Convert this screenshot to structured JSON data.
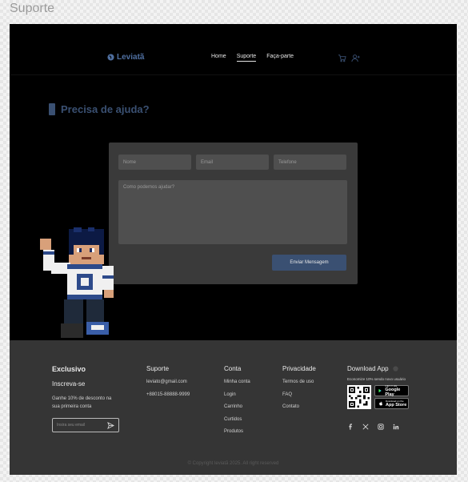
{
  "frame": {
    "title": "Suporte"
  },
  "header": {
    "brand": "Leviatã",
    "nav": [
      "Home",
      "Suporte",
      "Faça-parte"
    ],
    "active_index": 1
  },
  "help": {
    "title": "Precisa de ajuda?"
  },
  "form": {
    "name_placeholder": "Nome",
    "email_placeholder": "Email",
    "phone_placeholder": "Telefone",
    "message_placeholder": "Como podemos ajudar?",
    "submit_label": "Enviar Mensagem"
  },
  "footer": {
    "exclusive": {
      "title": "Exclusivo",
      "subtitle": "Inscreva-se",
      "text": "Ganhe 10% de desconto na sua primeira conta",
      "email_placeholder": "Insira seu email"
    },
    "support": {
      "title": "Suporte",
      "email": "leviato@gmail.com",
      "phone": "+88015-88888-9999"
    },
    "account": {
      "title": "Conta",
      "items": [
        "Minha conta",
        "Login",
        "Carrinho",
        "Curtidos",
        "Produtos"
      ]
    },
    "privacy": {
      "title": "Privacidade",
      "items": [
        "Termos de uso",
        "FAQ",
        "Contato"
      ]
    },
    "app": {
      "title": "Download App",
      "note": "Economize 10% sendo novo usuário",
      "google_small": "GET IT ON",
      "google_label": "Google Play",
      "apple_small": "Download on the",
      "apple_label": "App Store"
    },
    "copyright": "Copyright leviatã 2025. All right reserved"
  },
  "colors": {
    "accent": "#3a5072",
    "card": "#3a3a3a",
    "footer": "#353535"
  }
}
